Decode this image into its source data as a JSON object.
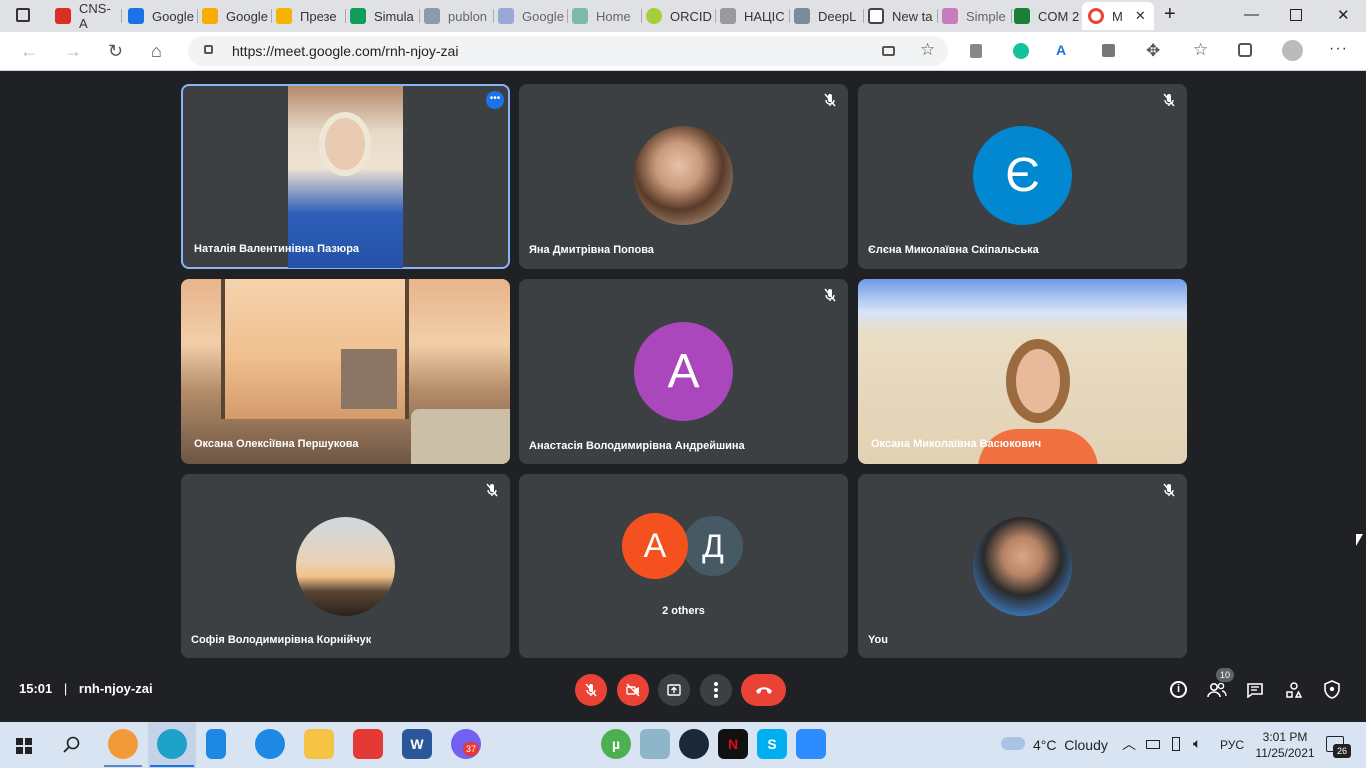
{
  "browser": {
    "tabs": [
      {
        "title": "CNS-A",
        "color": "#d93025"
      },
      {
        "title": "Google",
        "color": "#1a73e8"
      },
      {
        "title": "Google",
        "color": "#f9ab00"
      },
      {
        "title": "Презе",
        "color": "#f4b400"
      },
      {
        "title": "Simula",
        "color": "#0f9d58"
      },
      {
        "title": "publon",
        "color": "#8d99ae"
      },
      {
        "title": "Google",
        "color": "#9aa8d8"
      },
      {
        "title": "Home",
        "color": "#7cb9a8"
      },
      {
        "title": "ORCID",
        "color": "#a6ce39"
      },
      {
        "title": "НАЦІС",
        "color": "#999999"
      },
      {
        "title": "DeepL",
        "color": "#7d8a99"
      },
      {
        "title": "New ta",
        "color": "#444444"
      },
      {
        "title": "Simple",
        "color": "#c77dbb"
      },
      {
        "title": "COM 2",
        "color": "#188038"
      },
      {
        "title": "M",
        "color": "#ea4335"
      }
    ],
    "url": "https://meet.google.com/rnh-njoy-zai"
  },
  "tiles": [
    {
      "name": "Наталія Валентинівна Пазюра",
      "type": "video"
    },
    {
      "name": "Яна Дмитрівна Попова",
      "type": "photo-avatar"
    },
    {
      "name": "Єлєна Миколаївна Скіпальська",
      "type": "letter-avatar",
      "letter": "Є",
      "color": "#0288d1"
    },
    {
      "name": "Оксана Олексіївна Першукова",
      "type": "video"
    },
    {
      "name": "Анастасія Володимирівна Андрейшина",
      "type": "letter-avatar",
      "letter": "А",
      "color": "#ab47bc"
    },
    {
      "name": "Оксана Миколаївна Васюкович",
      "type": "video"
    },
    {
      "name": "Софія Володимирівна Корнійчук",
      "type": "photo-avatar"
    },
    {
      "name": "2 others",
      "type": "group",
      "letters": [
        "А",
        "Д"
      ],
      "colors": [
        "#f4511e",
        "#455a64"
      ]
    },
    {
      "name": "You",
      "type": "photo-avatar"
    }
  ],
  "meeting": {
    "time": "15:01",
    "separator": "|",
    "code": "rnh-njoy-zai",
    "participants_count": "10"
  },
  "taskbar": {
    "weather": "4°C  Cloudy",
    "lang": "РУС",
    "clock_time": "3:01 PM",
    "clock_date": "11/25/2021",
    "viber_badge": "37",
    "notification_count": "26"
  }
}
